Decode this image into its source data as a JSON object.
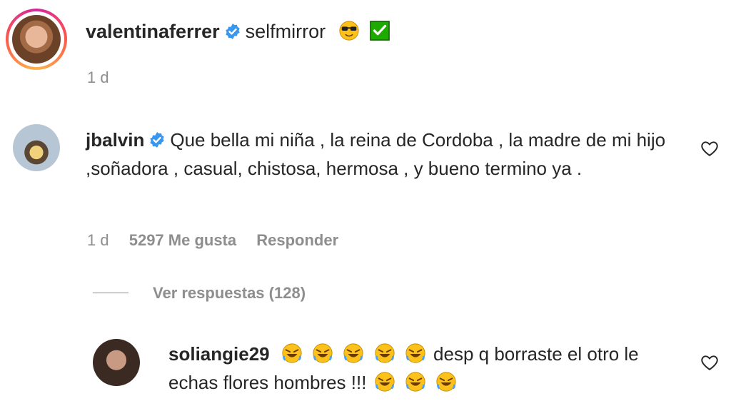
{
  "caption": {
    "username": "valentinaferrer",
    "text": "selfmirror",
    "emojis": [
      "sunglasses-face",
      "check-mark-box"
    ],
    "time": "1 d"
  },
  "comment": {
    "username": "jbalvin",
    "text": "Que bella mi niña , la reina de Cordoba , la madre de mi hijo ,soñadora , casual, chistosa, hermosa , y bueno termino ya .",
    "time": "1 d",
    "likes": "5297 Me gusta",
    "reply_label": "Responder",
    "view_replies": "Ver respuestas (128)"
  },
  "reply": {
    "username": "soliangie29",
    "text_part1": "desp q borraste el otro le echas flores hombres !!!",
    "emojis_before": [
      "rolling-laughing",
      "rolling-laughing",
      "rolling-laughing",
      "rolling-laughing",
      "rolling-laughing"
    ],
    "emojis_after": [
      "rolling-laughing",
      "rolling-laughing",
      "rolling-laughing"
    ]
  },
  "colors": {
    "text": "#262626",
    "secondary": "#8e8e8e",
    "verified": "#3897f0",
    "checkbox": "#1faa00"
  }
}
